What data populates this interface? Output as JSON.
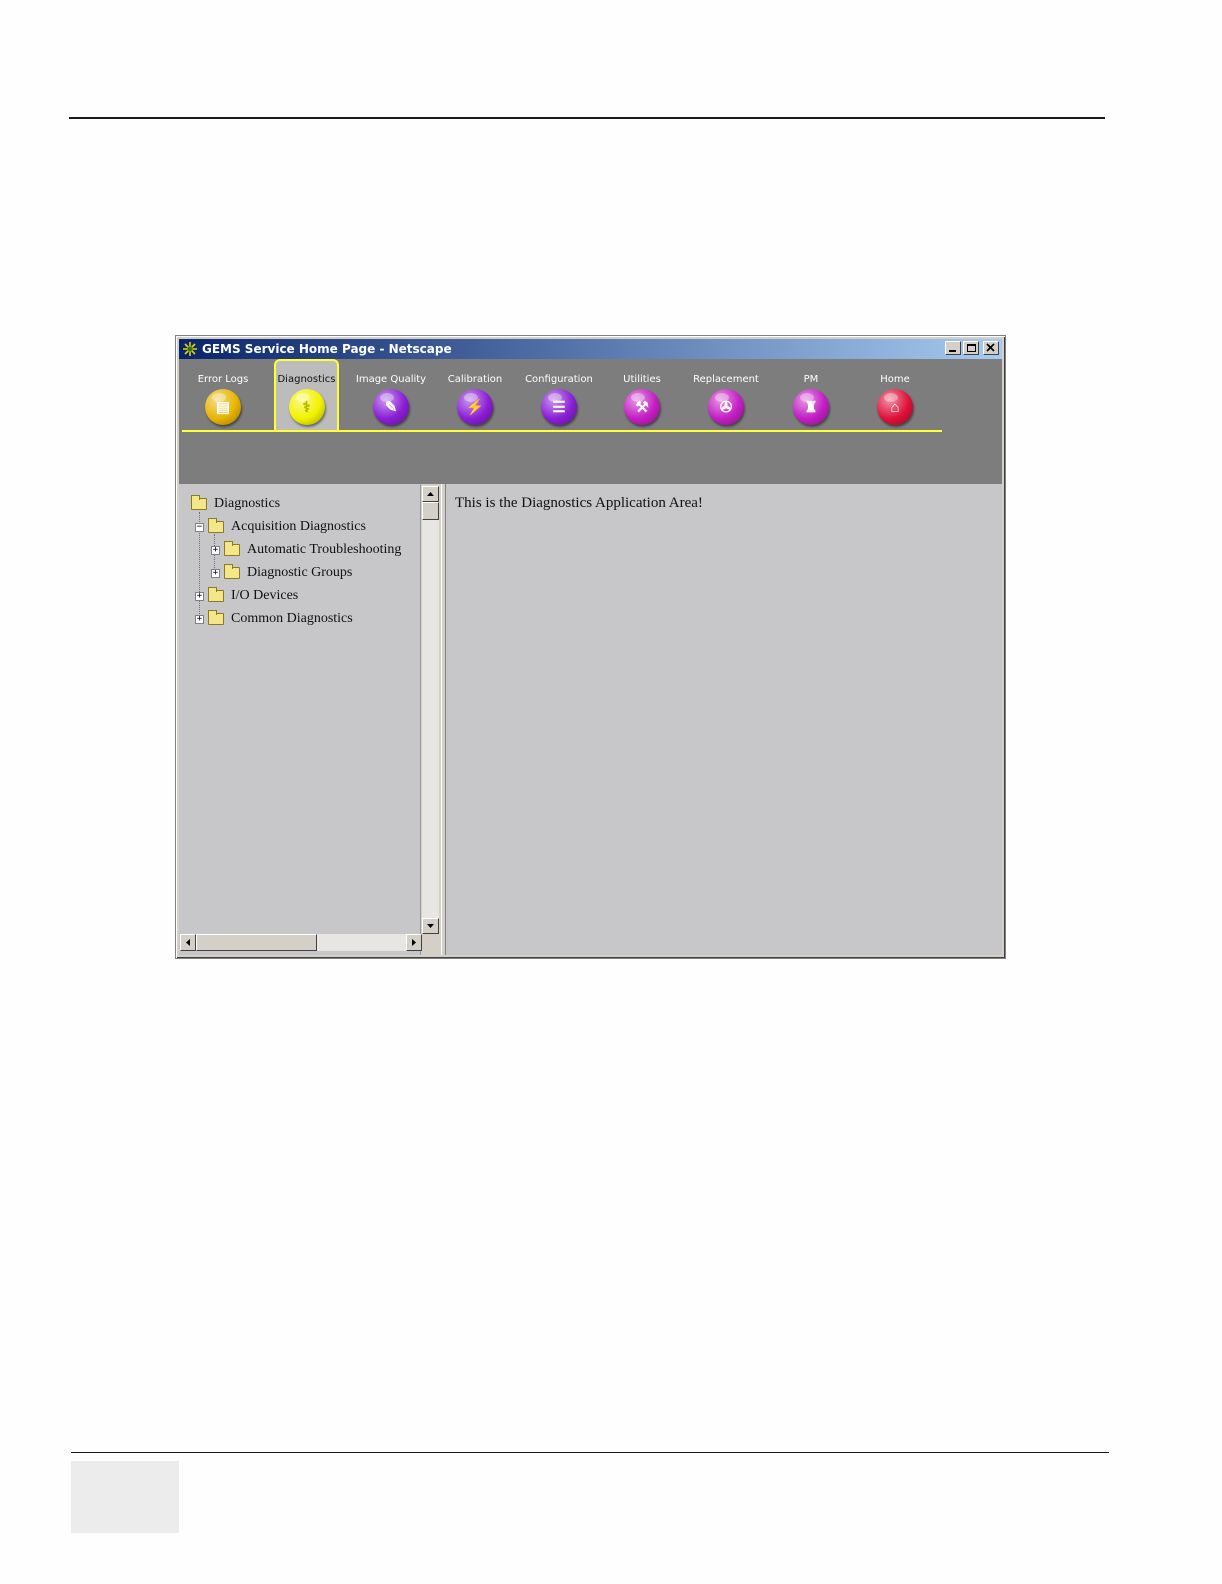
{
  "window": {
    "title": "GEMS Service Home Page - Netscape"
  },
  "nav": {
    "active": "Diagnostics",
    "items": [
      {
        "label": "Error Logs",
        "color": "#e8b400",
        "icon": "error-log-icon",
        "glyph": "▤"
      },
      {
        "label": "Diagnostics",
        "color": "#f2f200",
        "icon": "diagnostics-stethoscope-icon",
        "glyph": "⚕"
      },
      {
        "label": "Image Quality",
        "color": "#8a1ed6",
        "icon": "image-quality-icon",
        "glyph": "✎"
      },
      {
        "label": "Calibration",
        "color": "#8a1ed6",
        "icon": "calibration-icon",
        "glyph": "⚡"
      },
      {
        "label": "Configuration",
        "color": "#8a1ed6",
        "icon": "configuration-icon",
        "glyph": "☰"
      },
      {
        "label": "Utilities",
        "color": "#c41ec4",
        "icon": "utilities-toolbox-icon",
        "glyph": "⚒"
      },
      {
        "label": "Replacement",
        "color": "#c41ec4",
        "icon": "replacement-wrench-icon",
        "glyph": "✇"
      },
      {
        "label": "PM",
        "color": "#c41ec4",
        "icon": "pm-spray-icon",
        "glyph": "♜"
      },
      {
        "label": "Home",
        "color": "#e0103a",
        "icon": "home-house-icon",
        "glyph": "⌂"
      }
    ]
  },
  "tree": {
    "root": "Diagnostics",
    "acquisition": "Acquisition Diagnostics",
    "automatic": "Automatic Troubleshooting",
    "groups": "Diagnostic Groups",
    "io": "I/O Devices",
    "common": "Common Diagnostics"
  },
  "content": {
    "message": "This is the Diagnostics Application Area!"
  }
}
